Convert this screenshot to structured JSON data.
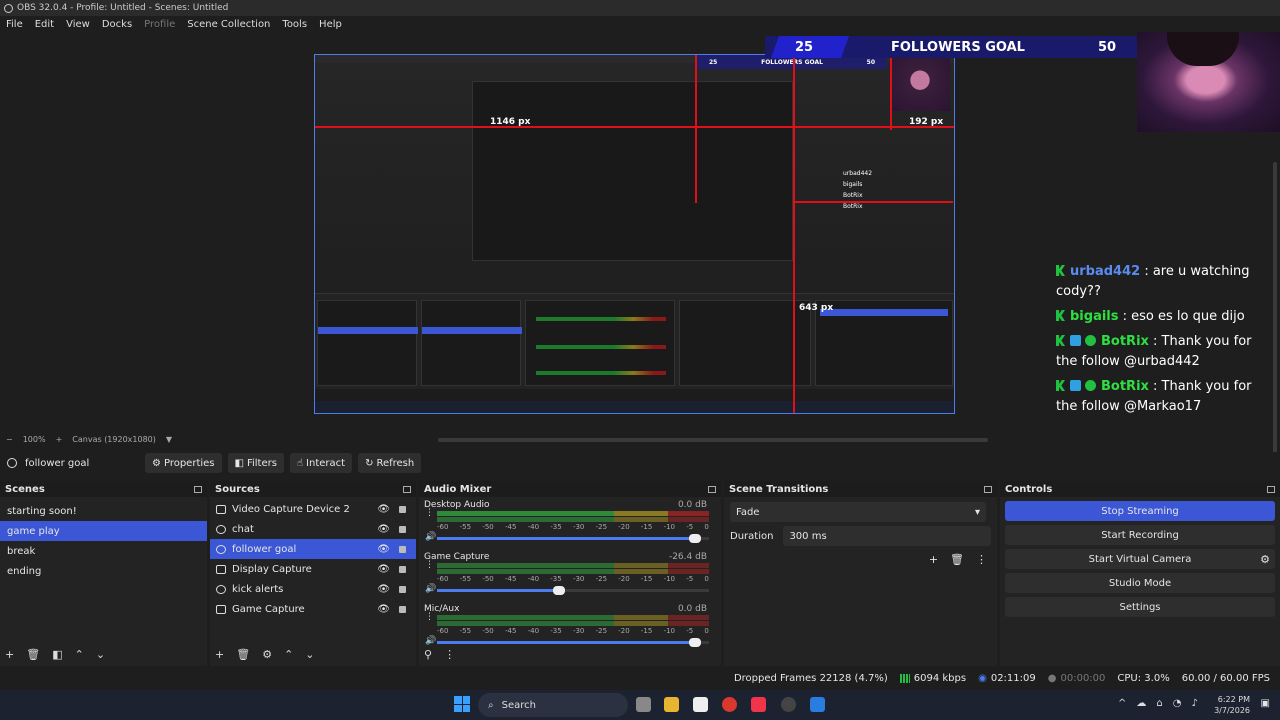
{
  "window": {
    "title": "OBS 32.0.4 - Profile: Untitled - Scenes: Untitled"
  },
  "menu": {
    "items": [
      "File",
      "Edit",
      "View",
      "Docks",
      "Profile",
      "Scene Collection",
      "Tools",
      "Help"
    ]
  },
  "overlay": {
    "goal_start": "25",
    "goal_title": "FOLLOWERS GOAL",
    "goal_end": "50",
    "measure_left": "1146 px",
    "measure_right": "192 px",
    "measure_bottom": "643 px",
    "chat": [
      {
        "user": "urbad442",
        "text": " : are u watching cody??",
        "style": "blue",
        "badges": [
          "kick"
        ]
      },
      {
        "user": "bigails",
        "text": " : eso es lo que dijo",
        "style": "green",
        "badges": [
          "kick"
        ]
      },
      {
        "user": "BotRix",
        "text": " : Thank you for the follow @urbad442",
        "style": "green",
        "badges": [
          "kick",
          "bot",
          "verified"
        ]
      },
      {
        "user": "BotRix",
        "text": " : Thank you for the follow @Markao17",
        "style": "green",
        "badges": [
          "kick",
          "bot",
          "verified"
        ]
      }
    ]
  },
  "canvas_bar": {
    "zoom": "100%",
    "canvas": "Canvas (1920x1080)"
  },
  "context": {
    "source": "follower goal",
    "properties": "Properties",
    "filters": "Filters",
    "interact": "Interact",
    "refresh": "Refresh"
  },
  "scenes": {
    "title": "Scenes",
    "items": [
      "starting soon!",
      "game play",
      "break",
      "ending"
    ],
    "selected": 1
  },
  "sources": {
    "title": "Sources",
    "items": [
      "Video Capture Device 2",
      "chat",
      "follower goal",
      "Display Capture",
      "kick alerts",
      "Game Capture"
    ],
    "selected": 2
  },
  "mixer": {
    "title": "Audio Mixer",
    "ticks": [
      "-60",
      "-55",
      "-50",
      "-45",
      "-40",
      "-35",
      "-30",
      "-25",
      "-20",
      "-15",
      "-10",
      "-5",
      "0"
    ],
    "channels": [
      {
        "name": "Desktop Audio",
        "db": "0.0 dB",
        "volume": 0.95,
        "live": true
      },
      {
        "name": "Game Capture",
        "db": "-26.4 dB",
        "volume": 0.45,
        "live": false
      },
      {
        "name": "Mic/Aux",
        "db": "0.0 dB",
        "volume": 0.95,
        "live": false
      }
    ]
  },
  "transitions": {
    "title": "Scene Transitions",
    "transition": "Fade",
    "duration_label": "Duration",
    "duration": "300 ms"
  },
  "controls": {
    "title": "Controls",
    "stop_streaming": "Stop Streaming",
    "start_recording": "Start Recording",
    "start_virtual_camera": "Start Virtual Camera",
    "studio_mode": "Studio Mode",
    "settings": "Settings"
  },
  "status": {
    "dropped": "Dropped Frames 22128 (4.7%)",
    "bitrate": "6094 kbps",
    "stream_time": "02:11:09",
    "rec_time": "00:00:00",
    "cpu": "CPU: 3.0%",
    "fps": "60.00 / 60.00 FPS"
  },
  "taskbar": {
    "search": "Search",
    "time": "6:22 PM",
    "date": "3/7/2026"
  },
  "colors": {
    "accent": "#3b57d6",
    "goal_bg": "#1a1a6a",
    "measure": "#e0101a"
  }
}
